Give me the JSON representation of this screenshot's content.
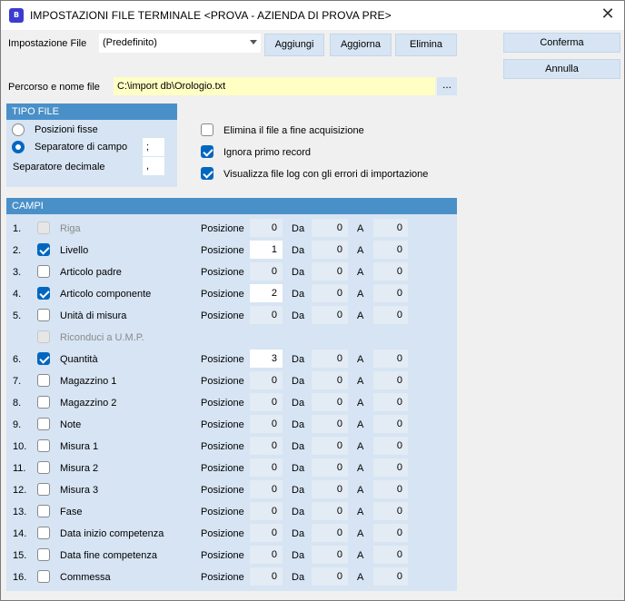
{
  "window": {
    "title": "IMPOSTAZIONI FILE TERMINALE <PROVA - AZIENDA DI PROVA PRE>",
    "icon": "app-icon",
    "close_glyph": "✕"
  },
  "impostazione": {
    "label": "Impostazione File",
    "value": "(Predefinito)"
  },
  "buttons": {
    "aggiungi": "Aggiungi",
    "aggiorna": "Aggiorna",
    "elimina": "Elimina",
    "conferma": "Conferma",
    "annulla": "Annulla",
    "browse": "..."
  },
  "percorso": {
    "label": "Percorso e nome file",
    "value": "C:\\import db\\Orologio.txt"
  },
  "tipo_file": {
    "header": "TIPO FILE",
    "posizioni_fisse": "Posizioni fisse",
    "separatore_campo": "Separatore di campo",
    "separatore_campo_value": ";",
    "separatore_decimale": "Separatore decimale",
    "separatore_decimale_value": ",",
    "selected": "separatore_campo"
  },
  "options": {
    "elimina_file": {
      "label": "Elimina il file a fine acquisizione",
      "checked": false
    },
    "ignora_primo": {
      "label": "Ignora primo record",
      "checked": true
    },
    "visualizza_log": {
      "label": "Visualizza file log con gli errori di importazione",
      "checked": true
    }
  },
  "campi": {
    "header": "CAMPI",
    "posizione_label": "Posizione",
    "da_label": "Da",
    "a_label": "A",
    "rows": [
      {
        "num": "1.",
        "name": "Riga",
        "checked": false,
        "disabled": true,
        "pos": "0",
        "da": "0",
        "a": "0"
      },
      {
        "num": "2.",
        "name": "Livello",
        "checked": true,
        "disabled": false,
        "pos": "1",
        "da": "0",
        "a": "0"
      },
      {
        "num": "3.",
        "name": "Articolo padre",
        "checked": false,
        "disabled": false,
        "pos": "0",
        "da": "0",
        "a": "0"
      },
      {
        "num": "4.",
        "name": "Articolo componente",
        "checked": true,
        "disabled": false,
        "pos": "2",
        "da": "0",
        "a": "0"
      },
      {
        "num": "5.",
        "name": "Unità di misura",
        "checked": false,
        "disabled": false,
        "pos": "0",
        "da": "0",
        "a": "0"
      },
      {
        "num": "",
        "name": "Riconduci a U.M.P.",
        "checked": false,
        "disabled": true,
        "only_check": true
      },
      {
        "num": "6.",
        "name": "Quantità",
        "checked": true,
        "disabled": false,
        "pos": "3",
        "da": "0",
        "a": "0"
      },
      {
        "num": "7.",
        "name": "Magazzino 1",
        "checked": false,
        "disabled": false,
        "pos": "0",
        "da": "0",
        "a": "0"
      },
      {
        "num": "8.",
        "name": "Magazzino 2",
        "checked": false,
        "disabled": false,
        "pos": "0",
        "da": "0",
        "a": "0"
      },
      {
        "num": "9.",
        "name": "Note",
        "checked": false,
        "disabled": false,
        "pos": "0",
        "da": "0",
        "a": "0"
      },
      {
        "num": "10.",
        "name": "Misura 1",
        "checked": false,
        "disabled": false,
        "pos": "0",
        "da": "0",
        "a": "0"
      },
      {
        "num": "11.",
        "name": "Misura 2",
        "checked": false,
        "disabled": false,
        "pos": "0",
        "da": "0",
        "a": "0"
      },
      {
        "num": "12.",
        "name": "Misura 3",
        "checked": false,
        "disabled": false,
        "pos": "0",
        "da": "0",
        "a": "0"
      },
      {
        "num": "13.",
        "name": "Fase",
        "checked": false,
        "disabled": false,
        "pos": "0",
        "da": "0",
        "a": "0"
      },
      {
        "num": "14.",
        "name": "Data inizio competenza",
        "checked": false,
        "disabled": false,
        "pos": "0",
        "da": "0",
        "a": "0"
      },
      {
        "num": "15.",
        "name": "Data fine competenza",
        "checked": false,
        "disabled": false,
        "pos": "0",
        "da": "0",
        "a": "0"
      },
      {
        "num": "16.",
        "name": "Commessa",
        "checked": false,
        "disabled": false,
        "pos": "0",
        "da": "0",
        "a": "0"
      }
    ]
  },
  "colors": {
    "accent": "#0067c0",
    "panel": "#d6e4f3",
    "header": "#4a90c8",
    "path_bg": "#ffffc4"
  }
}
